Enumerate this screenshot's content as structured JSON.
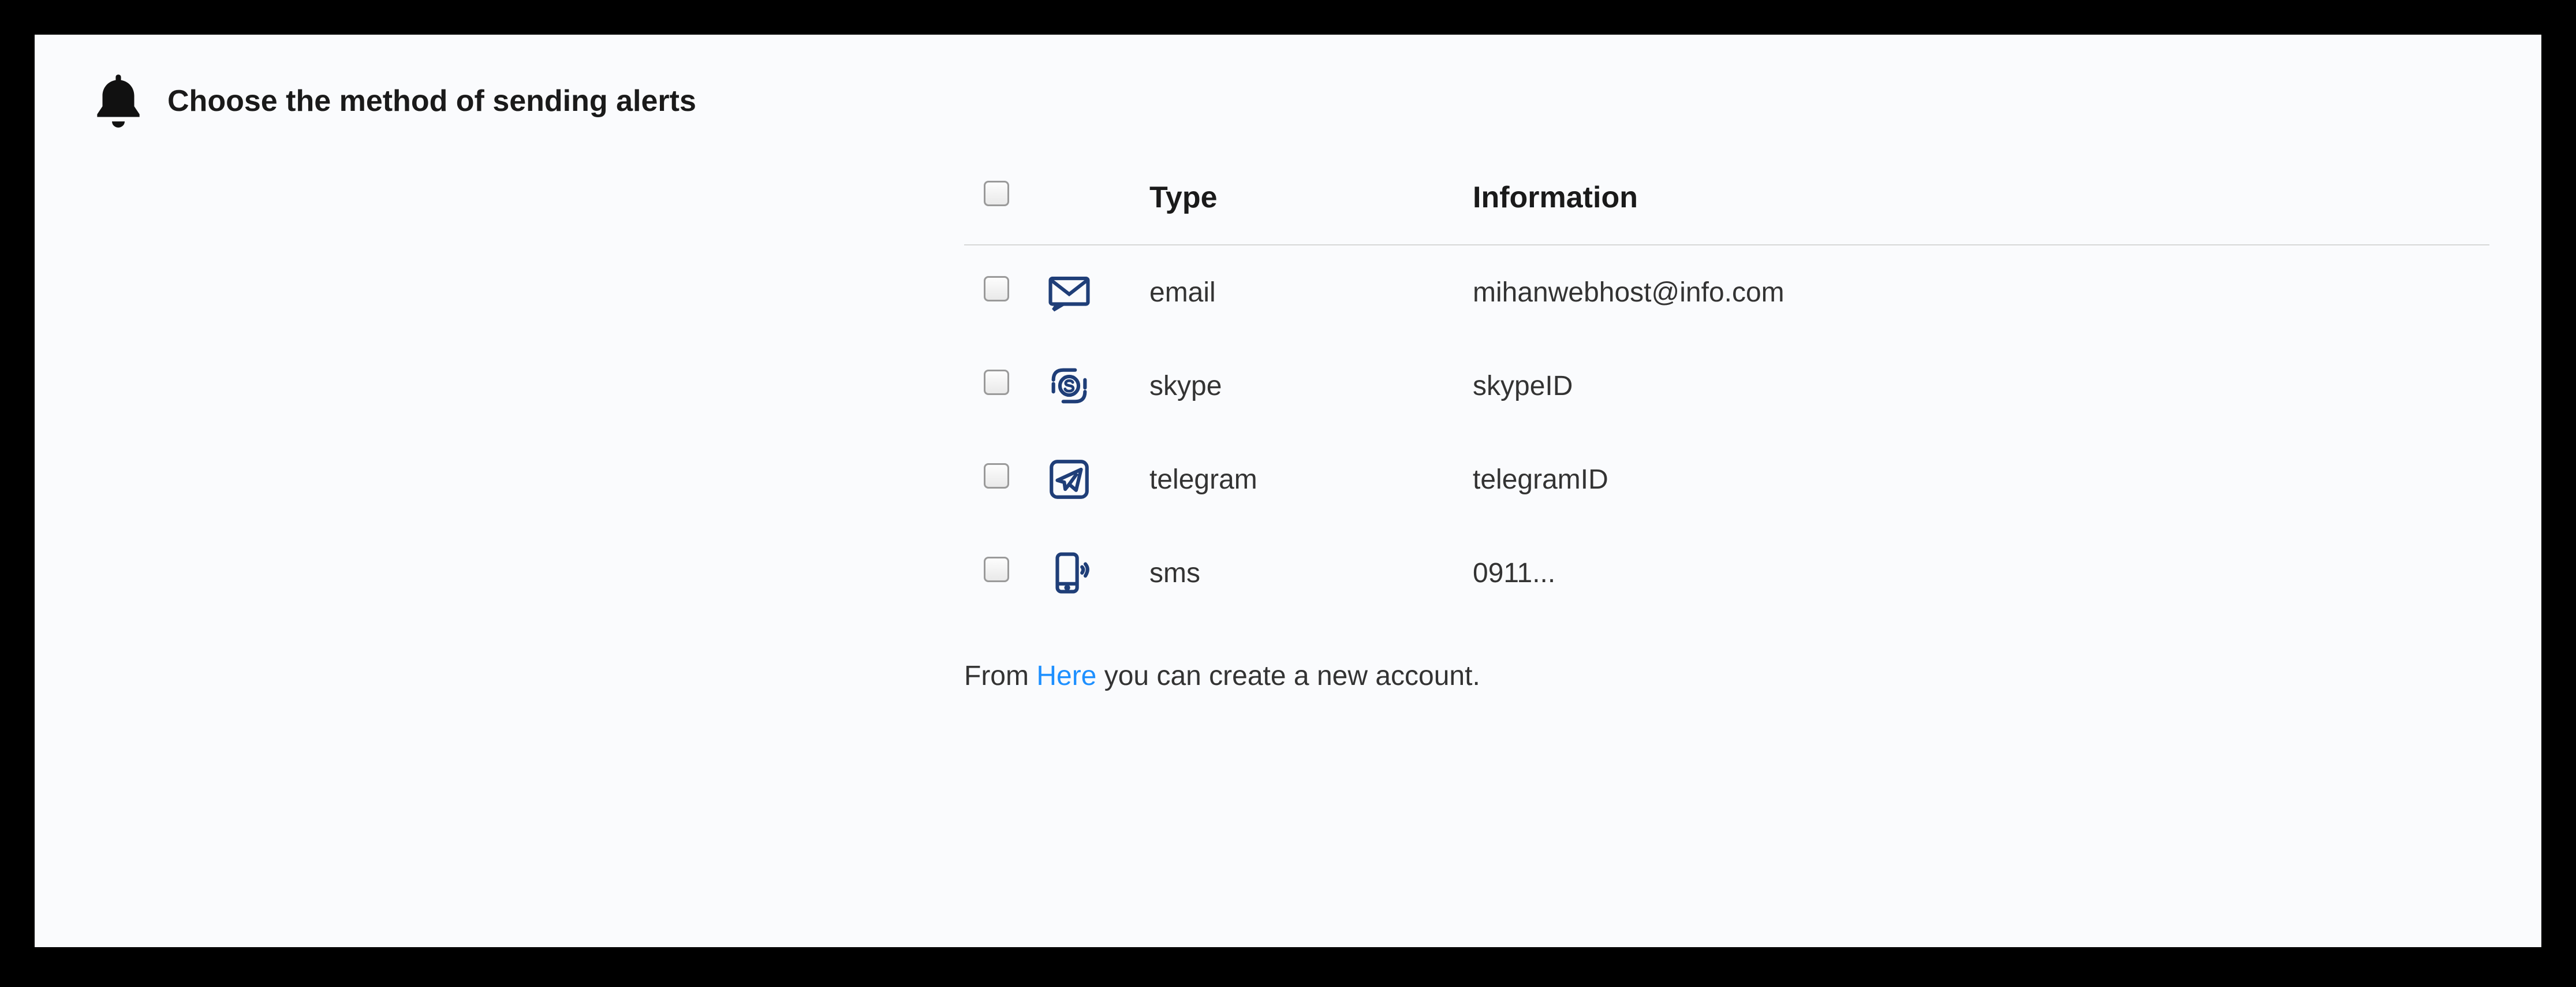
{
  "heading": "Choose the method of sending alerts",
  "columns": {
    "type": "Type",
    "info": "Information"
  },
  "rows": [
    {
      "icon": "email",
      "type": "email",
      "info": "mihanwebhost@info.com"
    },
    {
      "icon": "skype",
      "type": "skype",
      "info": "skypeID"
    },
    {
      "icon": "telegram",
      "type": "telegram",
      "info": "telegramID"
    },
    {
      "icon": "sms",
      "type": "sms",
      "info": "0911..."
    }
  ],
  "footer": {
    "prefix": "From ",
    "link": "Here",
    "suffix": " you can create a new account."
  },
  "colors": {
    "iconStroke": "#1F3E78",
    "link": "#1E90FF"
  }
}
